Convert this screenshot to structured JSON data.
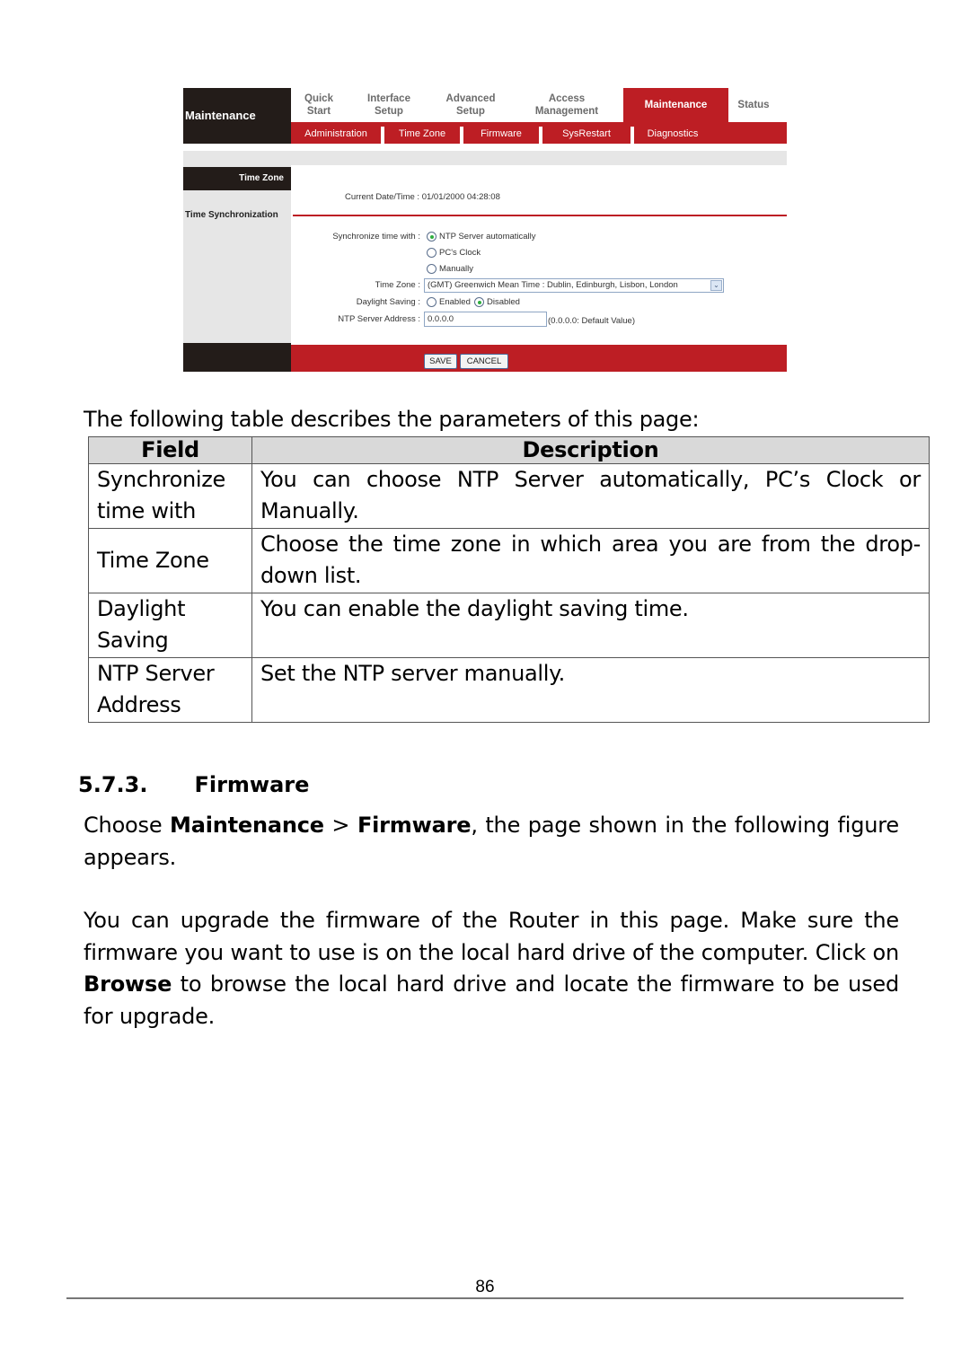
{
  "router": {
    "brand": "Maintenance",
    "top_tabs": [
      {
        "line1": "Quick",
        "line2": "Start"
      },
      {
        "line1": "Interface",
        "line2": "Setup"
      },
      {
        "line1": "Advanced",
        "line2": "Setup"
      },
      {
        "line1": "Access",
        "line2": "Management"
      },
      {
        "line1": "Maintenance",
        "line2": ""
      },
      {
        "line1": "Status",
        "line2": ""
      }
    ],
    "active_tab": "Maintenance",
    "sub_tabs": [
      "Administration",
      "Time Zone",
      "Firmware",
      "SysRestart",
      "Diagnostics"
    ],
    "section_head": "Time Zone",
    "section_label": "Time Synchronization",
    "current_datetime_label": "Current Date/Time :",
    "current_datetime_value": "01/01/2000 04:28:08",
    "sync_label": "Synchronize time with :",
    "sync_options": [
      "NTP Server automatically",
      "PC's Clock",
      "Manually"
    ],
    "sync_selected": "NTP Server automatically",
    "timezone_label": "Time Zone :",
    "timezone_value": "(GMT) Greenwich Mean Time : Dublin, Edinburgh, Lisbon, London",
    "daylight_label": "Daylight Saving :",
    "daylight_options": [
      "Enabled",
      "Disabled"
    ],
    "daylight_selected": "Disabled",
    "ntp_label": "NTP Server Address :",
    "ntp_value": "0.0.0.0",
    "ntp_hint": "(0.0.0.0: Default Value)",
    "save_label": "SAVE",
    "cancel_label": "CANCEL",
    "colors": {
      "accent": "#bd1e24",
      "dark": "#231c19",
      "panel": "#e6e6e6"
    }
  },
  "doc": {
    "intro": "The following table describes the parameters of this page:",
    "table": {
      "headers": [
        "Field",
        "Description"
      ],
      "rows": [
        {
          "field": "Synchronize time with",
          "description": "You can choose NTP Server automatically, PC’s Clock or Manually."
        },
        {
          "field": "Time Zone",
          "description": "Choose the time zone in which area you are from the drop-down list."
        },
        {
          "field": "Daylight Saving",
          "description": "You can enable the daylight saving time."
        },
        {
          "field": "NTP Server Address",
          "description": "Set the NTP server manually."
        }
      ]
    },
    "section_number": "5.7.3.",
    "section_title": "Firmware",
    "para1": {
      "pre": "Choose ",
      "bold1": "Maintenance",
      "mid": " > ",
      "bold2": "Firmware",
      "post": ", the page shown in the following figure appears."
    },
    "para2": {
      "pre": "You can upgrade the firmware of the Router in this page. Make sure the firmware you want to use is on the local hard drive of the computer. Click on ",
      "bold": "Browse",
      "post": " to browse the local hard drive and locate the firmware to be used for upgrade."
    },
    "page_number": "86"
  }
}
